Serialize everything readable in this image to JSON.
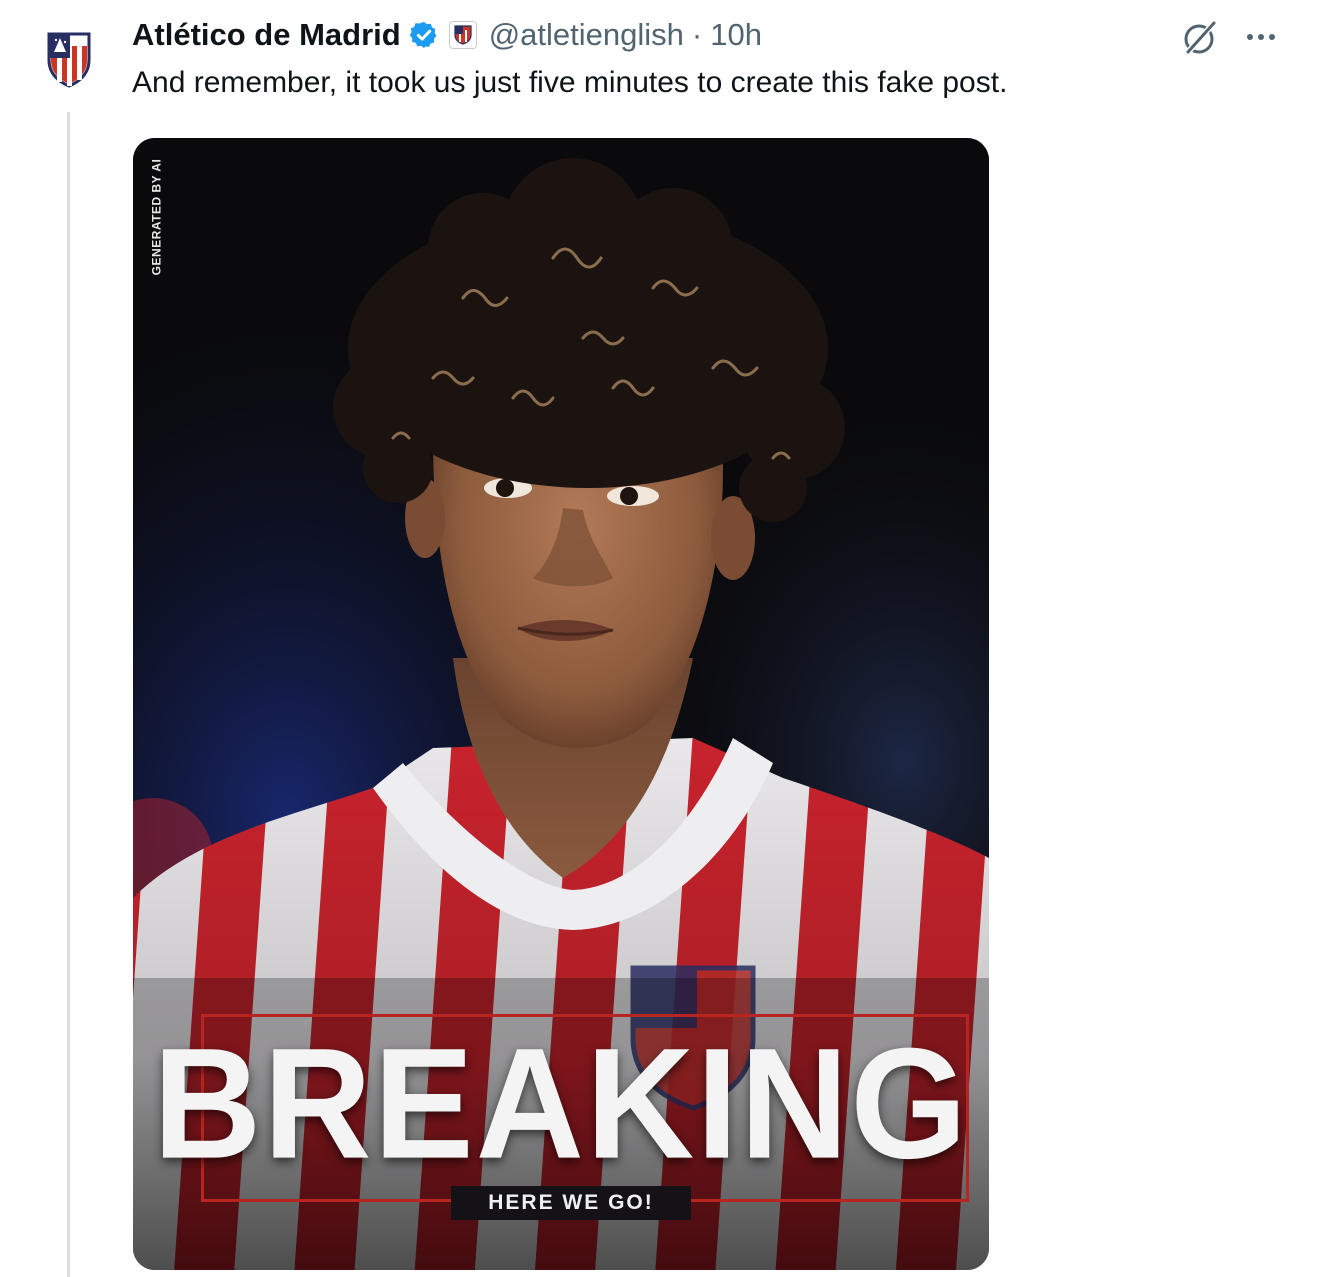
{
  "tweet": {
    "author_name": "Atlético de Madrid",
    "handle": "@atletienglish",
    "separator": "·",
    "time": "10h",
    "text": "And remember, it took us just five minutes to create this fake post."
  },
  "media": {
    "side_label": "GENERATED BY AI",
    "headline": "BREAKING",
    "subline": "HERE WE GO!"
  },
  "icons": {
    "verified": "verified-badge-icon",
    "affiliate": "club-affiliate-badge-icon",
    "grok": "grok-icon",
    "more": "more-options-icon"
  },
  "colors": {
    "verified_blue": "#1d9bf0",
    "club_red": "#cb3524",
    "club_blue": "#272e61",
    "text_primary": "#0f1419",
    "text_secondary": "#536471"
  }
}
